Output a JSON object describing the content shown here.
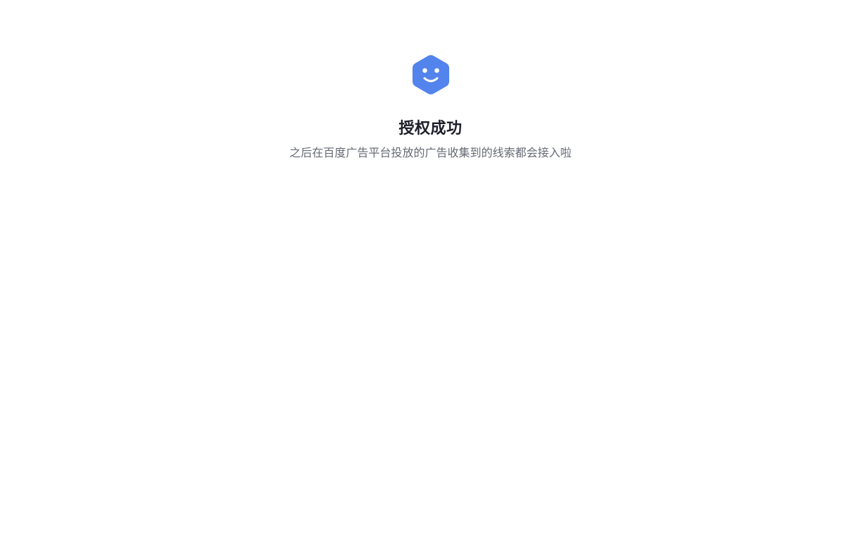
{
  "result": {
    "icon": "smiley-hexagon-icon",
    "icon_color": "#5383ec",
    "title": "授权成功",
    "description": "之后在百度广告平台投放的广告收集到的线索都会接入啦"
  }
}
